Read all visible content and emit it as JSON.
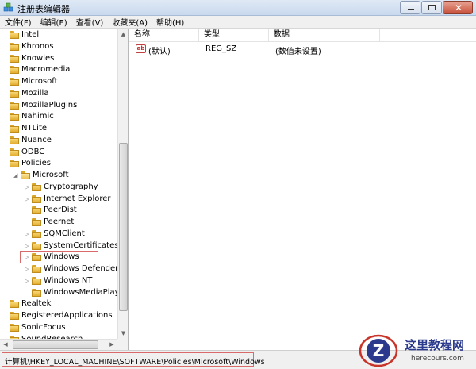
{
  "window": {
    "title": "注册表编辑器",
    "min_icon": "minimize-icon",
    "max_icon": "maximize-icon",
    "close_icon": "close-icon"
  },
  "menu": [
    "文件(F)",
    "编辑(E)",
    "查看(V)",
    "收藏夹(A)",
    "帮助(H)"
  ],
  "tree": [
    {
      "label": "Intel",
      "level": 0,
      "expander": "none"
    },
    {
      "label": "Khronos",
      "level": 0,
      "expander": "none"
    },
    {
      "label": "Knowles",
      "level": 0,
      "expander": "none"
    },
    {
      "label": "Macromedia",
      "level": 0,
      "expander": "none"
    },
    {
      "label": "Microsoft",
      "level": 0,
      "expander": "none"
    },
    {
      "label": "Mozilla",
      "level": 0,
      "expander": "none"
    },
    {
      "label": "MozillaPlugins",
      "level": 0,
      "expander": "none"
    },
    {
      "label": "Nahimic",
      "level": 0,
      "expander": "none"
    },
    {
      "label": "NTLite",
      "level": 0,
      "expander": "none"
    },
    {
      "label": "Nuance",
      "level": 0,
      "expander": "none"
    },
    {
      "label": "ODBC",
      "level": 0,
      "expander": "none"
    },
    {
      "label": "Policies",
      "level": 0,
      "expander": "none"
    },
    {
      "label": "Microsoft",
      "level": 1,
      "expander": "expanded"
    },
    {
      "label": "Cryptography",
      "level": 2,
      "expander": "collapsed"
    },
    {
      "label": "Internet Explorer",
      "level": 2,
      "expander": "collapsed"
    },
    {
      "label": "PeerDist",
      "level": 2,
      "expander": "none"
    },
    {
      "label": "Peernet",
      "level": 2,
      "expander": "none"
    },
    {
      "label": "SQMClient",
      "level": 2,
      "expander": "collapsed"
    },
    {
      "label": "SystemCertificates",
      "level": 2,
      "expander": "collapsed"
    },
    {
      "label": "Windows",
      "level": 2,
      "expander": "collapsed",
      "selected": true
    },
    {
      "label": "Windows Defender",
      "level": 2,
      "expander": "collapsed"
    },
    {
      "label": "Windows NT",
      "level": 2,
      "expander": "collapsed"
    },
    {
      "label": "WindowsMediaPlayer",
      "level": 2,
      "expander": "none"
    },
    {
      "label": "Realtek",
      "level": 0,
      "expander": "none"
    },
    {
      "label": "RegisteredApplications",
      "level": 0,
      "expander": "none"
    },
    {
      "label": "SonicFocus",
      "level": 0,
      "expander": "none"
    },
    {
      "label": "SoundResearch",
      "level": 0,
      "expander": "none"
    }
  ],
  "list": {
    "columns": [
      "名称",
      "类型",
      "数据"
    ],
    "rows": [
      {
        "icon": "string-value-icon",
        "icon_text": "ab",
        "name": "(默认)",
        "type": "REG_SZ",
        "data": "(数值未设置)"
      }
    ]
  },
  "status": {
    "path": "计算机\\HKEY_LOCAL_MACHINE\\SOFTWARE\\Policies\\Microsoft\\Windows"
  },
  "watermark": {
    "title": "这里教程网",
    "url": "herecours.com"
  },
  "colors": {
    "highlight_border": "#d86a6a"
  }
}
